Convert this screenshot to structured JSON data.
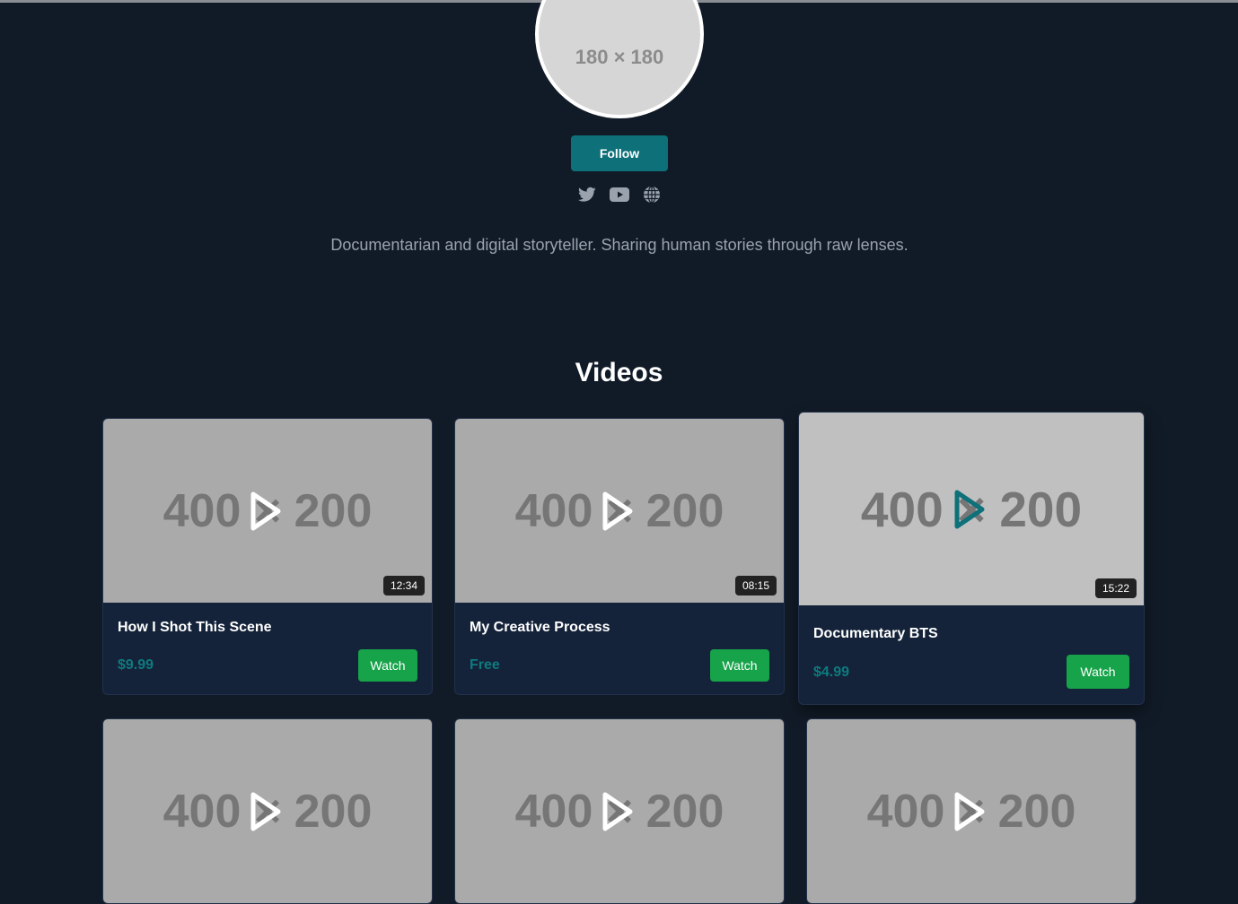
{
  "profile": {
    "avatar_placeholder": "180 × 180",
    "follow_label": "Follow",
    "bio": "Documentarian and digital storyteller. Sharing human stories through raw lenses.",
    "socials": [
      {
        "icon": "twitter-icon"
      },
      {
        "icon": "youtube-icon"
      },
      {
        "icon": "globe-icon"
      }
    ]
  },
  "videos_section": {
    "title": "Videos",
    "thumbnail_placeholder": "400 × 200",
    "items": [
      {
        "title": "How I Shot This Scene",
        "duration": "12:34",
        "price": "$9.99",
        "action": "Watch"
      },
      {
        "title": "My Creative Process",
        "duration": "08:15",
        "price": "Free",
        "action": "Watch"
      },
      {
        "title": "Documentary BTS",
        "duration": "15:22",
        "price": "$4.99",
        "action": "Watch"
      },
      {
        "title": "",
        "duration": "",
        "price": "",
        "action": ""
      },
      {
        "title": "",
        "duration": "",
        "price": "",
        "action": ""
      },
      {
        "title": "",
        "duration": "",
        "price": "",
        "action": ""
      }
    ]
  },
  "colors": {
    "background": "#111b27",
    "accent": "#0e7079",
    "watch_button": "#17a34a",
    "card": "#142339"
  }
}
